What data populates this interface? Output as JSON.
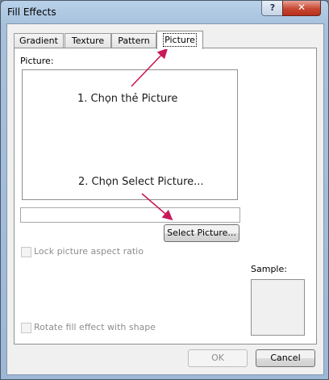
{
  "window": {
    "title": "Fill Effects",
    "help_glyph": "?",
    "close_glyph": "✕"
  },
  "tabs": [
    {
      "label": "Gradient",
      "active": false
    },
    {
      "label": "Texture",
      "active": false
    },
    {
      "label": "Pattern",
      "active": false
    },
    {
      "label": "Picture",
      "active": true
    }
  ],
  "picture_panel": {
    "picture_label": "Picture:",
    "filename_value": "",
    "select_button_label": "Select Picture...",
    "lock_aspect_label": "Lock picture aspect ratio",
    "lock_aspect_checked": false,
    "rotate_label": "Rotate fill effect with shape",
    "rotate_checked": false,
    "sample_label": "Sample:"
  },
  "annotations": {
    "step1": "1. Chọn thẻ Picture",
    "step2": "2. Chọn Select Picture...",
    "arrow_color": "#c8185a"
  },
  "buttons": {
    "ok": "OK",
    "cancel": "Cancel"
  }
}
